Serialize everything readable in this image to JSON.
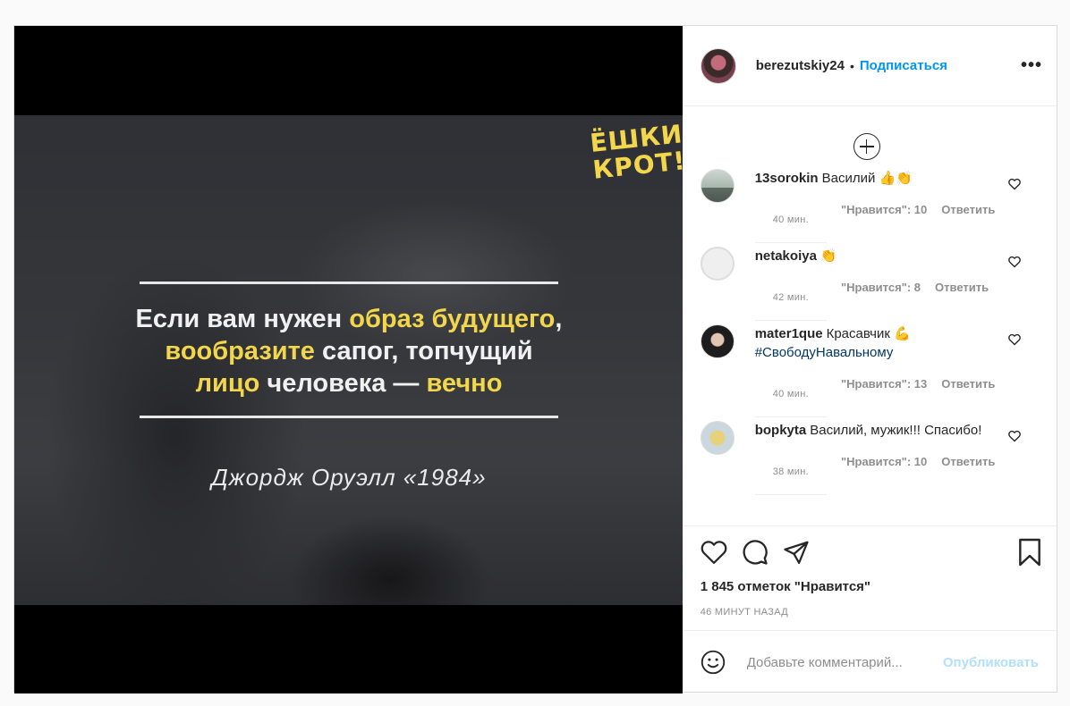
{
  "post": {
    "media": {
      "logo_line1": "ЁШКИН",
      "logo_line2": "КРОТ!",
      "quote_lines": [
        [
          {
            "t": "Если вам нужен ",
            "hl": false
          },
          {
            "t": "образ будущего",
            "hl": true
          },
          {
            "t": ",",
            "hl": false
          }
        ],
        [
          {
            "t": "вообразите",
            "hl": true
          },
          {
            "t": " сапог, топчущий",
            "hl": false
          }
        ],
        [
          {
            "t": "лицо",
            "hl": true
          },
          {
            "t": " человека — ",
            "hl": false
          },
          {
            "t": "вечно",
            "hl": true
          }
        ]
      ],
      "author": "Джордж Оруэлл «1984»",
      "highlight_color": "#f2d64b"
    },
    "header": {
      "username": "berezutskiy24",
      "separator": "•",
      "follow_label": "Подписаться",
      "more_label": "•••"
    },
    "comments": [
      {
        "username": "13sorokin",
        "text": "Василий",
        "emoji": "👍👏",
        "hashtag": "",
        "time": "40 мин.",
        "likes": "\"Нравится\": 10",
        "reply": "Ответить"
      },
      {
        "username": "netakoiya",
        "text": "",
        "emoji": "👏",
        "hashtag": "",
        "time": "42 мин.",
        "likes": "\"Нравится\": 8",
        "reply": "Ответить"
      },
      {
        "username": "mater1que",
        "text": "Красавчик",
        "emoji": "💪",
        "hashtag": "#СвободуНавальному",
        "time": "40 мин.",
        "likes": "\"Нравится\": 13",
        "reply": "Ответить"
      },
      {
        "username": "bopkyta",
        "text": "Василий, мужик!!! Спасибо!",
        "emoji": "",
        "hashtag": "",
        "time": "38 мин.",
        "likes": "\"Нравится\": 10",
        "reply": "Ответить"
      }
    ],
    "likes_text": "1 845 отметок \"Нравится\"",
    "posted_time": "46 МИНУТ НАЗАД",
    "comment_input": {
      "placeholder": "Добавьте комментарий...",
      "post_label": "Опубликовать"
    },
    "colors": {
      "link_blue": "#0095f6",
      "post_disabled": "#b2dffc",
      "hashtag": "#00376b"
    }
  }
}
